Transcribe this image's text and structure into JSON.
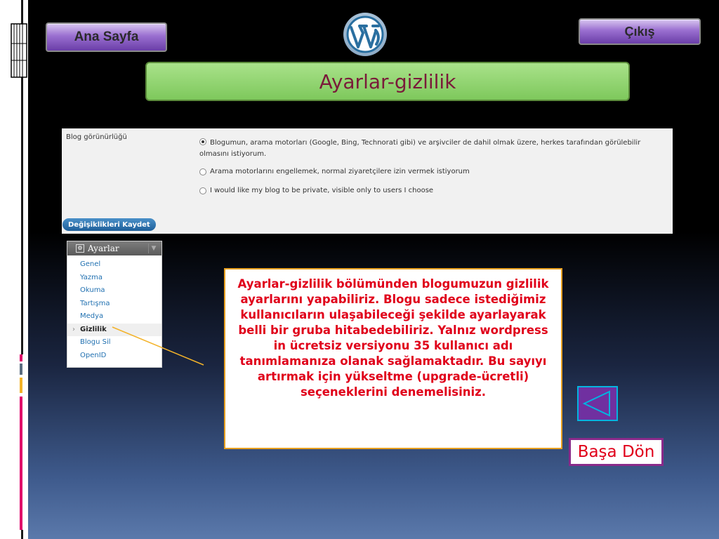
{
  "nav": {
    "home_label": "Ana Sayfa",
    "exit_label": "Çıkış"
  },
  "title": "Ayarlar-gizlilik",
  "settings": {
    "label": "Blog görünürlüğü",
    "options": [
      {
        "text_line1": "Blogumun, arama motorları (Google, Bing, Technorati gibi) ve arşivciler de dahil olmak üzere, herkes tarafından görülebilir",
        "text_line2": "olmasını istiyorum.",
        "selected": true
      },
      {
        "text_line1": "Arama motorlarını engellemek, normal ziyaretçilere izin vermek istiyorum",
        "selected": false
      },
      {
        "text_line1": "I would like my blog to be private, visible only to users I choose",
        "selected": false
      }
    ],
    "save_label": "Değişiklikleri Kaydet"
  },
  "menu": {
    "header": "Ayarlar",
    "items": [
      "Genel",
      "Yazma",
      "Okuma",
      "Tartışma",
      "Medya",
      "Gizlilik",
      "Blogu Sil",
      "OpenID"
    ],
    "active": "Gizlilik"
  },
  "info_text": "Ayarlar-gizlilik bölümünden blogumuzun gizlilik ayarlarını yapabiliriz. Blogu sadece istediğimiz kullanıcıların ulaşabileceği şekilde ayarlayarak belli bir gruba hitabedebiliriz. Yalnız wordpress in ücretsiz versiyonu 35 kullanıcı adı tanımlamanıza olanak sağlamaktadır.  Bu sayıyı artırmak için yükseltme (upgrade-ücretli) seçeneklerini denemelisiniz.",
  "back_to_top_label": "Başa Dön",
  "icons": {
    "logo": "wordpress-logo-icon",
    "back": "triangle-left-icon",
    "doc": "document-stack-icon"
  },
  "colors": {
    "title_bg": "#7ec85c",
    "title_text": "#7a1a3a",
    "info_text": "#e0001a",
    "info_border": "#e8a020",
    "nav_button": "#9a6fd0",
    "back_btn_bg": "#7030a0",
    "back_btn_border": "#00b4e0"
  }
}
